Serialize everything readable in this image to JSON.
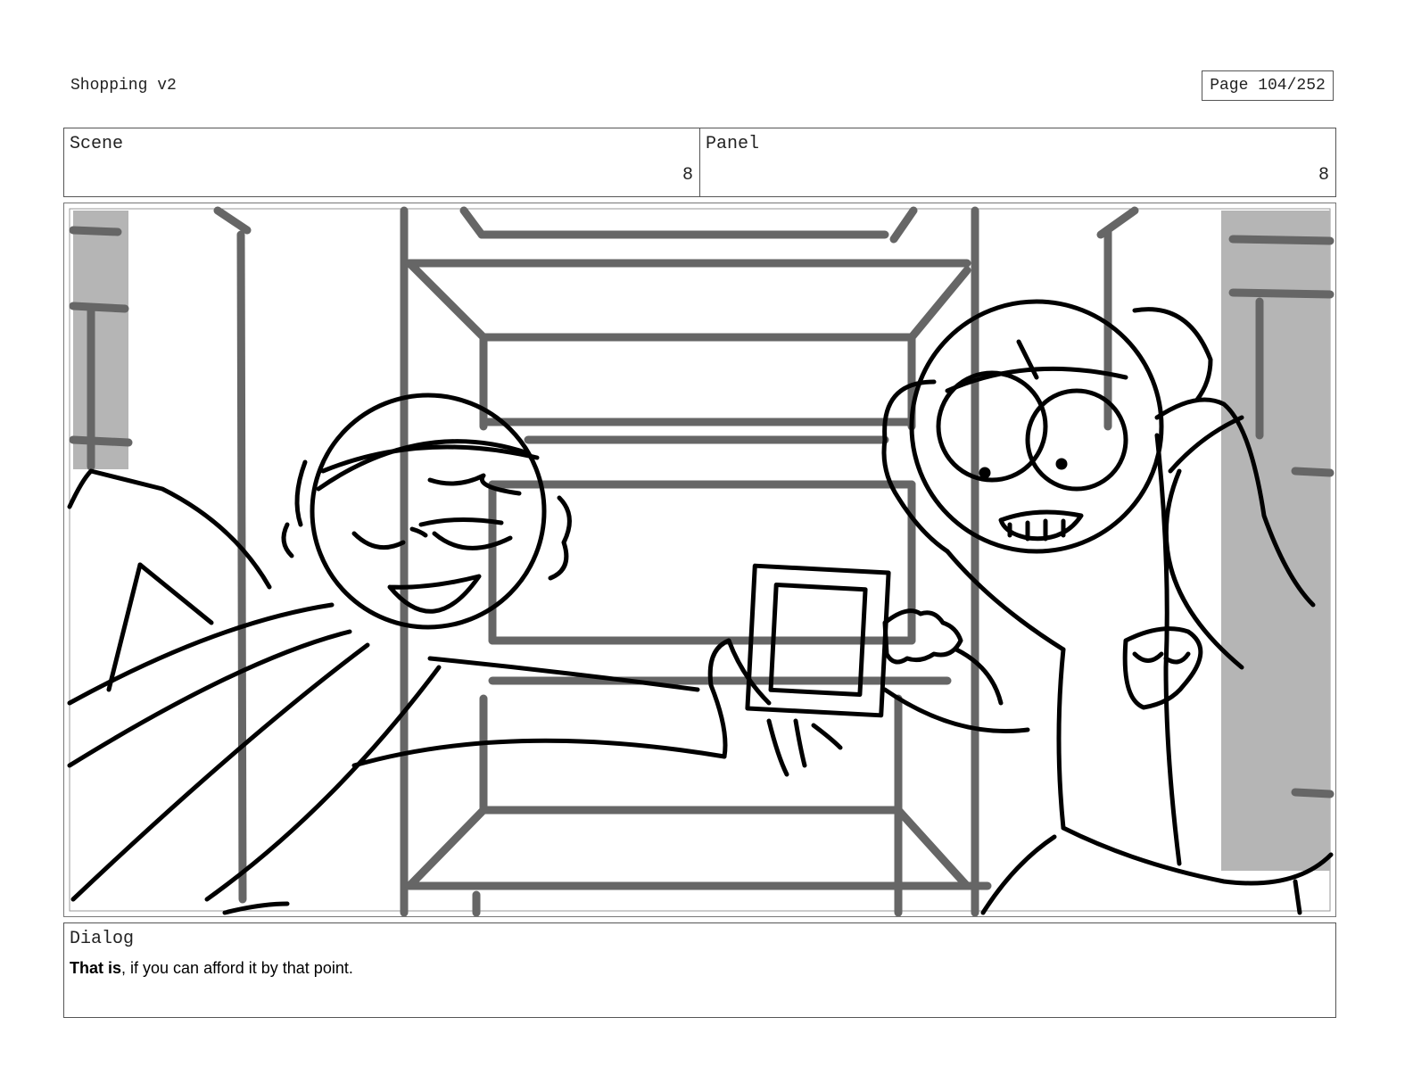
{
  "header": {
    "project_title": "Shopping v2",
    "page_label": "Page 104/252"
  },
  "info": {
    "scene_label": "Scene",
    "scene_value": "8",
    "panel_label": "Panel",
    "panel_value": "8"
  },
  "dialog": {
    "label": "Dialog",
    "bold_text": "That is",
    "rest_text": ", if you can afford it by that point."
  }
}
